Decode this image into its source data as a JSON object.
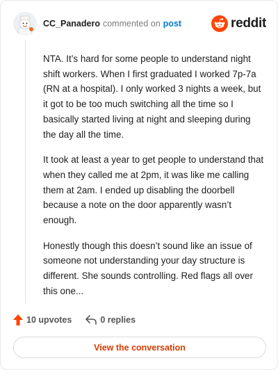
{
  "header": {
    "username": "CC_Panadero",
    "action": "commented on",
    "link": "post",
    "brand": "reddit"
  },
  "comment": {
    "paragraphs": [
      "NTA. It’s hard for some people to understand night shift workers. When I first graduated I worked 7p-7a (RN at a hospital). I only worked 3 nights a week, but it got to be too much switching all the time so I basically started living at night and sleeping during the day all the time.",
      "It took at least a year to get people to understand that when they called me at 2pm, it was like me calling them at 2am. I ended up disabling the doorbell because a note on the door apparently wasn’t enough.",
      "Honestly though this doesn’t sound like an issue of someone not understanding your day structure is different. She sounds controlling. Red flags all over this one..."
    ]
  },
  "footer": {
    "upvotes": "10 upvotes",
    "replies": "0 replies"
  },
  "cta": {
    "label": "View the conversation"
  },
  "colors": {
    "accent": "#ff4500",
    "link": "#0079d3",
    "cta_text": "#d93a00"
  },
  "icons": {
    "avatar": "user-avatar",
    "brand": "reddit-logo-icon",
    "upvote": "upvote-arrow-icon",
    "reply": "reply-arrow-icon"
  }
}
